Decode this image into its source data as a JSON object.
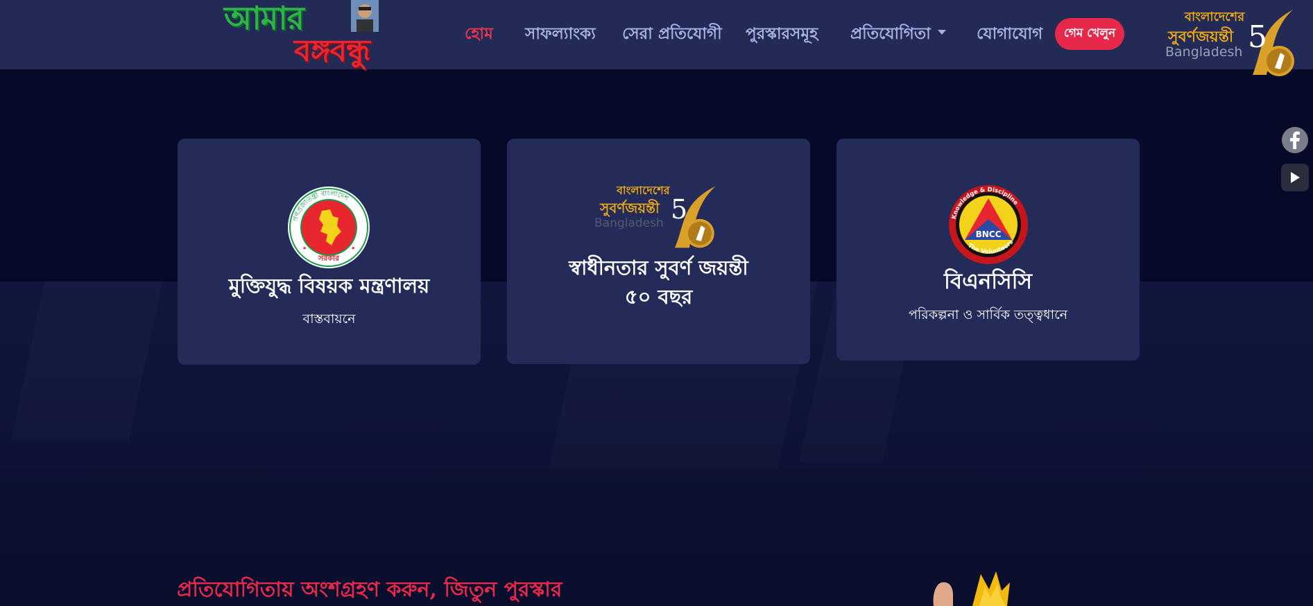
{
  "header": {
    "logo_left": {
      "line1": "আমার",
      "line2": "বঙ্গবন্ধু"
    },
    "nav": [
      {
        "label": "হোম",
        "active": true
      },
      {
        "label": "সাফল্যাংক্য"
      },
      {
        "label": "সেরা প্রতিযোগী"
      },
      {
        "label": "পুরস্কারসমূহ"
      },
      {
        "label": "প্রতিযোগিতা",
        "dropdown": true
      },
      {
        "label": "যোগাযোগ"
      }
    ],
    "play_button": "গেম খেলুন",
    "logo_right": {
      "bn_top": "বাংলাদেশের",
      "bn_main": "সুবর্ণজয়ন্তী",
      "en": "Bangladesh",
      "number": "5"
    }
  },
  "side_links": [
    {
      "icon": "facebook-icon"
    },
    {
      "icon": "youtube-icon"
    }
  ],
  "cards": [
    {
      "logo": "government-seal-icon",
      "seal_top": "গণপ্রজাতন্ত্রী বাংলাদেশ",
      "seal_bottom": "সরকার",
      "title": "মুক্তিযুদ্ধ বিষয়ক মন্ত্রণালয়",
      "subtitle": "বাস্তবায়নে"
    },
    {
      "logo": "golden-jubilee-logo",
      "logo_bn_top": "বাংলাদেশের",
      "logo_bn_main": "সুবর্ণজয়ন্তী",
      "logo_en": "Bangladesh",
      "logo_number": "5",
      "title_line1": "স্বাধীনতার সুবর্ণ জয়ন্তী",
      "title_line2": "৫০ বছর"
    },
    {
      "logo": "bncc-emblem-icon",
      "emblem_top": "Knowledge & Discipline",
      "emblem_center": "BNCC",
      "emblem_bottom": "The Volunteers",
      "title": "বিএনসিসি",
      "subtitle": "পরিকল্পনা ও সার্বিক তত্ত্বধানে"
    }
  ],
  "cta": {
    "text": "প্রতিযোগিতায় অংশগ্রহণ করুন, জিতুন পুরস্কার"
  },
  "colors": {
    "navbar_bg": "#232a55",
    "page_bg": "#060a28",
    "card_bg": "#242b59",
    "accent_red": "#e6284a",
    "nav_text": "#a9b1e3",
    "gold": "#e8a817"
  }
}
